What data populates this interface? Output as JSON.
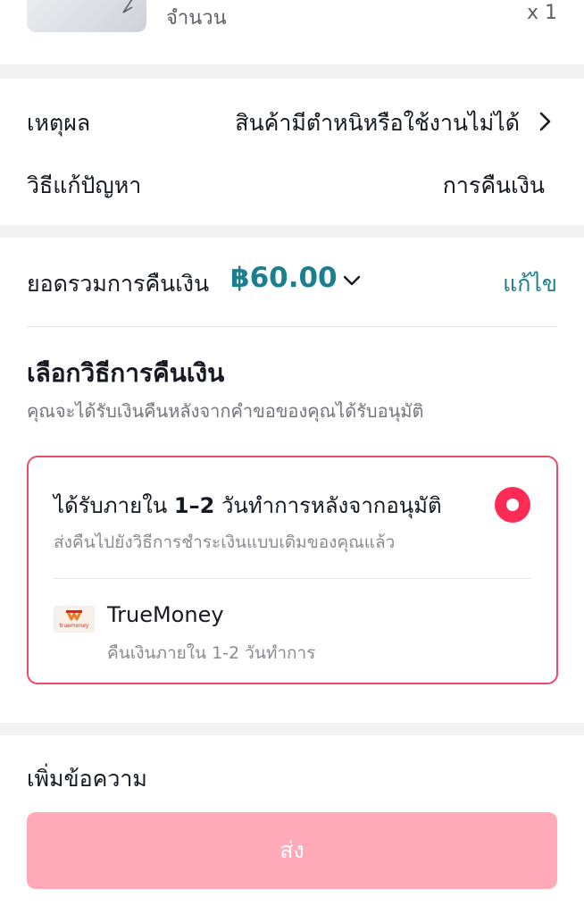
{
  "product": {
    "quantity_label": "จำนวน",
    "quantity_value": "x 1"
  },
  "details": {
    "reason_label": "เหตุผล",
    "reason_value": "สินค้ามีตำหนิหรือใช้งานไม่ได้",
    "solution_label": "วิธีแก้ปัญหา",
    "solution_value": "การคืนเงิน"
  },
  "refund": {
    "total_label": "ยอดรวมการคืนเงิน",
    "total_amount": "฿60.00",
    "edit_label": "แก้ไข",
    "method_title": "เลือกวิธีการคืนเงิน",
    "method_subtitle": "คุณจะได้รับเงินคืนหลังจากคำขอของคุณได้รับอนุมัติ",
    "option": {
      "title_prefix": "ได้รับภายใน ",
      "title_bold": "1–2",
      "title_suffix": " วันทำการหลังจากอนุมัติ",
      "subtitle": "ส่งคืนไปยังวิธีการชำระเงินแบบเดิมของคุณแล้ว",
      "selected": true,
      "provider_name": "TrueMoney",
      "provider_logo_text": "truemoney",
      "provider_note": "คืนเงินภายใน 1-2 วันทำการ"
    }
  },
  "footer": {
    "note_label": "เพิ่มข้อความ",
    "send_label": "ส่ง"
  },
  "colors": {
    "accent_teal": "#1b7f90",
    "selected_red": "#fe2c55",
    "card_border": "#ec4b6b",
    "button_disabled": "#ffa9b9"
  }
}
